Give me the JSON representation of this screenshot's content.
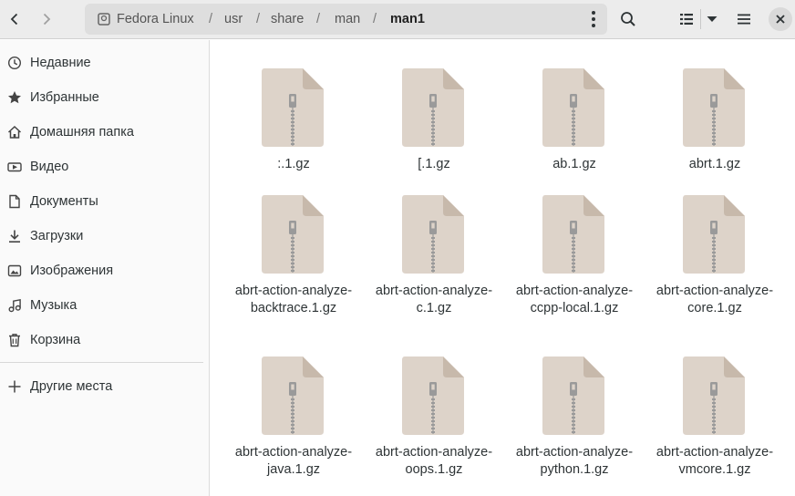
{
  "header": {
    "breadcrumbs": [
      "Fedora Linux",
      "usr",
      "share",
      "man",
      "man1"
    ],
    "separator": "/",
    "icons": {
      "back": "chevron-left-icon",
      "forward": "chevron-right-icon",
      "disk": "drive-icon",
      "path_menu": "vertical-dots-icon",
      "search": "search-icon",
      "view": "list-view-icon",
      "view_options": "triangle-down-icon",
      "menu": "hamburger-icon",
      "close": "close-icon"
    }
  },
  "sidebar": {
    "items": [
      {
        "label": "Недавние",
        "icon": "clock-icon"
      },
      {
        "label": "Избранные",
        "icon": "star-icon"
      },
      {
        "label": "Домашняя папка",
        "icon": "home-icon"
      },
      {
        "label": "Видео",
        "icon": "video-icon"
      },
      {
        "label": "Документы",
        "icon": "document-icon"
      },
      {
        "label": "Загрузки",
        "icon": "download-icon"
      },
      {
        "label": "Изображения",
        "icon": "image-icon"
      },
      {
        "label": "Музыка",
        "icon": "music-icon"
      },
      {
        "label": "Корзина",
        "icon": "trash-icon"
      }
    ],
    "other": {
      "label": "Другие места",
      "icon": "plus-icon"
    }
  },
  "files": [
    {
      "name": ":.1.gz"
    },
    {
      "name": "[.1.gz"
    },
    {
      "name": "ab.1.gz"
    },
    {
      "name": "abrt.1.gz"
    },
    {
      "name": "abrt-action-analyze-backtrace.1.gz"
    },
    {
      "name": "abrt-action-analyze-c.1.gz"
    },
    {
      "name": "abrt-action-analyze-ccpp-local.1.gz"
    },
    {
      "name": "abrt-action-analyze-core.1.gz"
    },
    {
      "name": "abrt-action-analyze-java.1.gz"
    },
    {
      "name": "abrt-action-analyze-oops.1.gz"
    },
    {
      "name": "abrt-action-analyze-python.1.gz"
    },
    {
      "name": "abrt-action-analyze-vmcore.1.gz"
    }
  ],
  "colors": {
    "file_icon": "#ddd3c9",
    "file_fold": "#c7b9ab",
    "zipper": "#9a9a9a"
  }
}
